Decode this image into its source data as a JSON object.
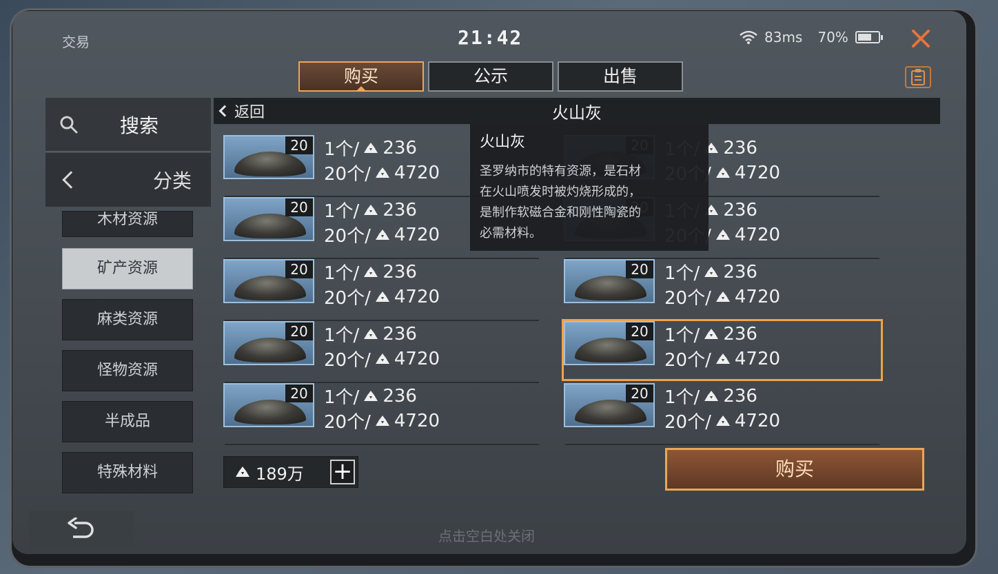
{
  "status": {
    "app_title": "交易",
    "clock": "21:42",
    "ping": "83ms",
    "battery": "70%",
    "battery_level": 0.7
  },
  "tabs": [
    {
      "label": "购买",
      "active": true
    },
    {
      "label": "公示",
      "active": false
    },
    {
      "label": "出售",
      "active": false
    }
  ],
  "sidebar": {
    "search_label": "搜索",
    "category_label": "分类",
    "items": [
      {
        "label": "木材资源"
      },
      {
        "label": "矿产资源",
        "selected": true
      },
      {
        "label": "麻类资源"
      },
      {
        "label": "怪物资源"
      },
      {
        "label": "半成品"
      },
      {
        "label": "特殊材料"
      }
    ]
  },
  "panel": {
    "back_label": "返回",
    "title": "火山灰"
  },
  "listings": [
    {
      "qty": "20",
      "unit_line": "1个/",
      "unit_price": "236",
      "bulk_line": "20个/",
      "bulk_price": "4720"
    },
    {
      "qty": "20",
      "unit_line": "1个/",
      "unit_price": "236",
      "bulk_line": "20个/",
      "bulk_price": "4720"
    },
    {
      "qty": "20",
      "unit_line": "1个/",
      "unit_price": "236",
      "bulk_line": "20个/",
      "bulk_price": "4720"
    },
    {
      "qty": "20",
      "unit_line": "1个/",
      "unit_price": "236",
      "bulk_line": "20个/",
      "bulk_price": "4720"
    },
    {
      "qty": "20",
      "unit_line": "1个/",
      "unit_price": "236",
      "bulk_line": "20个/",
      "bulk_price": "4720"
    },
    {
      "qty": "20",
      "unit_line": "1个/",
      "unit_price": "236",
      "bulk_line": "20个/",
      "bulk_price": "4720"
    },
    {
      "qty": "20",
      "unit_line": "1个/",
      "unit_price": "236",
      "bulk_line": "20个/",
      "bulk_price": "4720"
    },
    {
      "qty": "20",
      "unit_line": "1个/",
      "unit_price": "236",
      "bulk_line": "20个/",
      "bulk_price": "4720"
    },
    {
      "qty": "20",
      "unit_line": "1个/",
      "unit_price": "236",
      "bulk_line": "20个/",
      "bulk_price": "4720"
    },
    {
      "qty": "20",
      "unit_line": "1个/",
      "unit_price": "236",
      "bulk_line": "20个/",
      "bulk_price": "4720"
    }
  ],
  "tooltip": {
    "title": "火山灰",
    "lines": [
      "圣罗纳市的特有资源，是石材",
      "在火山喷发时被灼烧形成的，",
      "是制作软磁合金和刚性陶瓷的",
      "必需材料。"
    ]
  },
  "balance": "189万",
  "buy_button": "购买",
  "close_hint": "点击空白处关闭",
  "colors": {
    "accent": "#e8a85a",
    "close": "#e8743a",
    "highlight": "#f0a24a"
  }
}
